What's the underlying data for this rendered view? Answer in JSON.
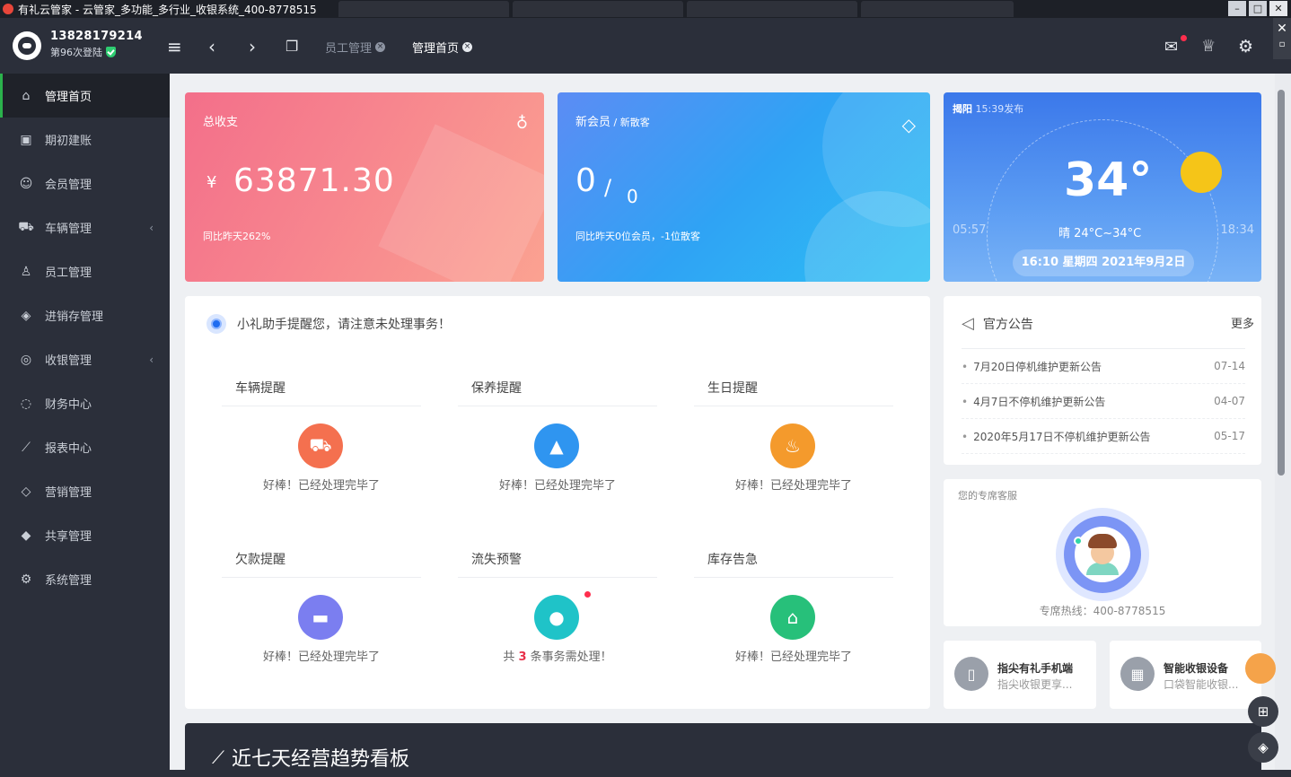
{
  "window": {
    "title": "有礼云管家 - 云管家_多功能_多行业_收银系统_400-8778515"
  },
  "account": {
    "phone": "13828179214",
    "logins": "第96次登陆"
  },
  "header": {
    "tabs": [
      {
        "label": "员工管理"
      },
      {
        "label": "管理首页"
      }
    ]
  },
  "sidebar": {
    "items": [
      {
        "label": "管理首页",
        "icon": "home-icon"
      },
      {
        "label": "期初建账",
        "icon": "calendar-icon"
      },
      {
        "label": "会员管理",
        "icon": "user-icon"
      },
      {
        "label": "车辆管理",
        "icon": "car-icon"
      },
      {
        "label": "员工管理",
        "icon": "staff-icon"
      },
      {
        "label": "进销存管理",
        "icon": "box-icon"
      },
      {
        "label": "收银管理",
        "icon": "money-icon"
      },
      {
        "label": "财务中心",
        "icon": "finance-icon"
      },
      {
        "label": "报表中心",
        "icon": "chart-icon"
      },
      {
        "label": "营销管理",
        "icon": "tag-icon"
      },
      {
        "label": "共享管理",
        "icon": "diamond-icon"
      },
      {
        "label": "系统管理",
        "icon": "gear-icon"
      }
    ]
  },
  "kpi": {
    "income": {
      "label": "总收支",
      "currency": "¥",
      "value": "63871.30",
      "note": "同比昨天262%"
    },
    "members": {
      "label": "新会员",
      "label_small": " / 新散客",
      "value_main": "0",
      "value_sep": "/",
      "value_sub": "0",
      "note": "同比昨天0位会员，-1位散客"
    }
  },
  "weather": {
    "city": "揭阳",
    "published": "15:39发布",
    "temp": "34°",
    "range": "晴 24°C~34°C",
    "sunrise": "05:57",
    "sunset": "18:34",
    "datetime": "16:10 星期四 2021年9月2日"
  },
  "reminders": {
    "header": "小礼助手提醒您，请注意未处理事务！",
    "items": [
      {
        "title": "车辆提醒",
        "msg": "好棒！已经处理完毕了",
        "color": "#f4704f"
      },
      {
        "title": "保养提醒",
        "msg": "好棒！已经处理完毕了",
        "color": "#2f95f0"
      },
      {
        "title": "生日提醒",
        "msg": "好棒！已经处理完毕了",
        "color": "#f49a2c"
      },
      {
        "title": "欠款提醒",
        "msg": "好棒！已经处理完毕了",
        "color": "#7b7ef0"
      },
      {
        "title": "流失预警",
        "msg_pre": "共",
        "msg_count": "3",
        "msg_post": "条事务需处理！",
        "color": "#1fc3c8"
      },
      {
        "title": "库存告急",
        "msg": "好棒！已经处理完毕了",
        "color": "#27c07a"
      }
    ]
  },
  "notice": {
    "title": "官方公告",
    "more": "更多",
    "items": [
      {
        "text": "7月20日停机维护更新公告",
        "date": "07-14"
      },
      {
        "text": "4月7日不停机维护更新公告",
        "date": "04-07"
      },
      {
        "text": "2020年5月17日不停机维护更新公告",
        "date": "05-17"
      }
    ]
  },
  "service": {
    "label": "您的专席客服",
    "hotline": "专席热线：400-8778515"
  },
  "promos": [
    {
      "title": "指尖有礼手机端",
      "sub": "指尖收银更享..."
    },
    {
      "title": "智能收银设备",
      "sub": "口袋智能收银..."
    }
  ],
  "trend": {
    "title": "近七天经营趋势看板"
  }
}
